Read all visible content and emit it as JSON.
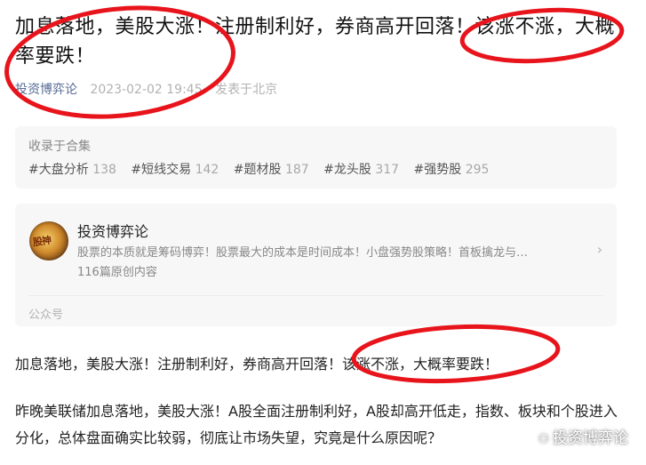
{
  "article": {
    "title": "加息落地，美股大涨！注册制利好，券商高开回落！该涨不涨，大概率要跌！",
    "author": "投资博弈论",
    "date": "2023-02-02 19:45",
    "location": "发表于北京"
  },
  "collection": {
    "label": "收录于合集",
    "tags": [
      {
        "name": "#大盘分析",
        "count": "138"
      },
      {
        "name": "#短线交易",
        "count": "142"
      },
      {
        "name": "#题材股",
        "count": "187"
      },
      {
        "name": "#龙头股",
        "count": "317"
      },
      {
        "name": "#强势股",
        "count": "295"
      }
    ]
  },
  "account": {
    "name": "投资博弈论",
    "description": "股票的本质就是筹码博弈！股票最大的成本是时间成本！小盘强势股策略！首板擒龙与…",
    "count": "116篇原创内容",
    "type": "公众号",
    "arrow_icon": "chevron-right-icon"
  },
  "body": {
    "p1": "加息落地，美股大涨！注册制利好，券商高开回落！该涨不涨，大概率要跌！",
    "p2": "昨晚美联储加息落地，美股大涨！A股全面注册制利好，A股却高开低走，指数、板块和个股进入分化，总体盘面确实比较弱，彻底让市场失望，究竟是什么原因呢？"
  },
  "watermark": {
    "text": "投资博弈论",
    "icon": "wechat-icon"
  },
  "colors": {
    "annotation": "#e8141c",
    "link": "#576b95",
    "card_bg": "#f7f7f7"
  }
}
